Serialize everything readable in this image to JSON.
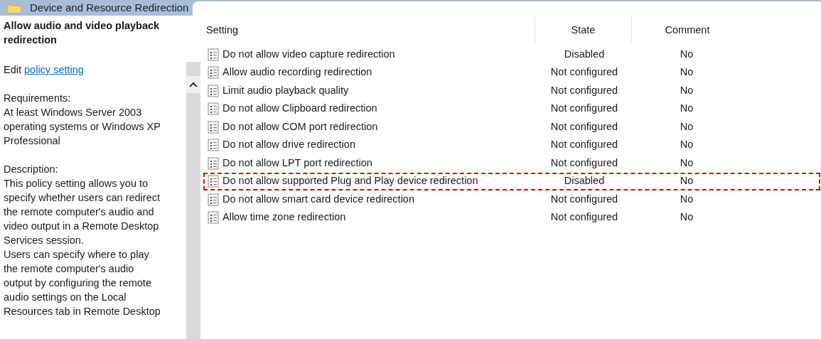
{
  "header": {
    "title": "Device and Resource Redirection"
  },
  "details": {
    "title": "Allow audio and video playback redirection",
    "edit_prefix": "Edit",
    "edit_link": "policy setting",
    "requirements": [
      "Requirements:",
      "At least Windows Server 2003",
      "operating systems or Windows XP",
      "Professional"
    ],
    "description": [
      "Description:",
      "This policy setting allows you to",
      "specify whether users can redirect",
      "the remote computer's audio and",
      "video output in a Remote Desktop",
      "Services session.",
      "Users can specify where to play",
      "the remote computer's audio",
      "output by configuring the remote",
      "audio settings on the Local",
      "Resources tab in Remote Desktop"
    ]
  },
  "table": {
    "columns": [
      "Setting",
      "State",
      "Comment"
    ],
    "rows": [
      {
        "setting": "Do not allow video capture redirection",
        "state": "Disabled",
        "comment": "No",
        "highlighted": false
      },
      {
        "setting": "Allow audio recording redirection",
        "state": "Not configured",
        "comment": "No",
        "highlighted": false
      },
      {
        "setting": "Limit audio playback quality",
        "state": "Not configured",
        "comment": "No",
        "highlighted": false
      },
      {
        "setting": "Do not allow Clipboard redirection",
        "state": "Not configured",
        "comment": "No",
        "highlighted": false
      },
      {
        "setting": "Do not allow COM port redirection",
        "state": "Not configured",
        "comment": "No",
        "highlighted": false
      },
      {
        "setting": "Do not allow drive redirection",
        "state": "Not configured",
        "comment": "No",
        "highlighted": false
      },
      {
        "setting": "Do not allow LPT port redirection",
        "state": "Not configured",
        "comment": "No",
        "highlighted": false
      },
      {
        "setting": "Do not allow supported Plug and Play device redirection",
        "state": "Disabled",
        "comment": "No",
        "highlighted": true
      },
      {
        "setting": "Do not allow smart card device redirection",
        "state": "Not configured",
        "comment": "No",
        "highlighted": false
      },
      {
        "setting": "Allow time zone redirection",
        "state": "Not configured",
        "comment": "No",
        "highlighted": false
      }
    ]
  }
}
